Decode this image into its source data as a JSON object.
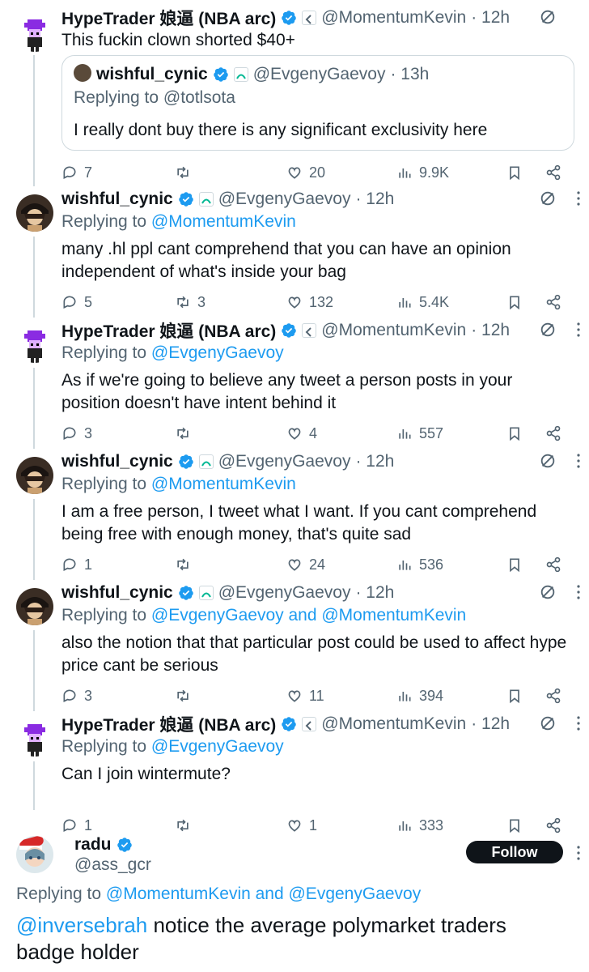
{
  "tweets": [
    {
      "name": "HypeTrader 娘逼 (NBA arc)",
      "handle": "@MomentumKevin",
      "time": "· 12h",
      "reply_to_prefix": "",
      "reply_to": "",
      "text": "This fuckin clown shorted $40+",
      "quote": {
        "name": "wishful_cynic",
        "handle": "@EvgenyGaevoy",
        "time": "· 13h",
        "reply_to": "Replying to @totlsota",
        "text": "I really dont buy there is any significant exclusivity here"
      },
      "replies": "7",
      "retweets": "",
      "likes": "20",
      "views": "9.9K"
    },
    {
      "name": "wishful_cynic",
      "handle": "@EvgenyGaevoy",
      "time": "· 12h",
      "reply_to_prefix": "Replying to ",
      "reply_to": "@MomentumKevin",
      "text": "many .hl ppl cant comprehend that you can have an opinion independent of what's inside your bag",
      "replies": "5",
      "retweets": "3",
      "likes": "132",
      "views": "5.4K"
    },
    {
      "name": "HypeTrader 娘逼 (NBA arc)",
      "handle": "@MomentumKevin",
      "time": "· 12h",
      "reply_to_prefix": "Replying to ",
      "reply_to": "@EvgenyGaevoy",
      "text": "As if we're going to believe any tweet a person posts in your position doesn't have intent behind it",
      "replies": "3",
      "retweets": "",
      "likes": "4",
      "views": "557"
    },
    {
      "name": "wishful_cynic",
      "handle": "@EvgenyGaevoy",
      "time": "· 12h",
      "reply_to_prefix": "Replying to ",
      "reply_to": "@MomentumKevin",
      "text": "I am a free person, I tweet what I want. If you cant comprehend being free with enough money, that's quite sad",
      "replies": "1",
      "retweets": "",
      "likes": "24",
      "views": "536"
    },
    {
      "name": "wishful_cynic",
      "handle": "@EvgenyGaevoy",
      "time": "· 12h",
      "reply_to_prefix": "Replying to ",
      "reply_to": "@EvgenyGaevoy and @MomentumKevin",
      "text": "also the notion that that particular post could be used to affect hype price cant be serious",
      "replies": "3",
      "retweets": "",
      "likes": "11",
      "views": "394"
    },
    {
      "name": "HypeTrader 娘逼 (NBA arc)",
      "handle": "@MomentumKevin",
      "time": "· 12h",
      "reply_to_prefix": "Replying to ",
      "reply_to": "@EvgenyGaevoy",
      "text": "Can I join wintermute?",
      "replies": "1",
      "retweets": "",
      "likes": "1",
      "views": "333"
    }
  ],
  "focus": {
    "name": "radu",
    "handle": "@ass_gcr",
    "follow_label": "Follow",
    "reply_to_prefix": "Replying to ",
    "reply_to": "@MomentumKevin and @EvgenyGaevoy",
    "mention": "@inversebrah",
    "text": " notice the average polymarket traders badge holder"
  },
  "colors": {
    "link": "#1d9bf0",
    "muted": "#536471",
    "text": "#0f1419",
    "border": "#cfd9de"
  }
}
